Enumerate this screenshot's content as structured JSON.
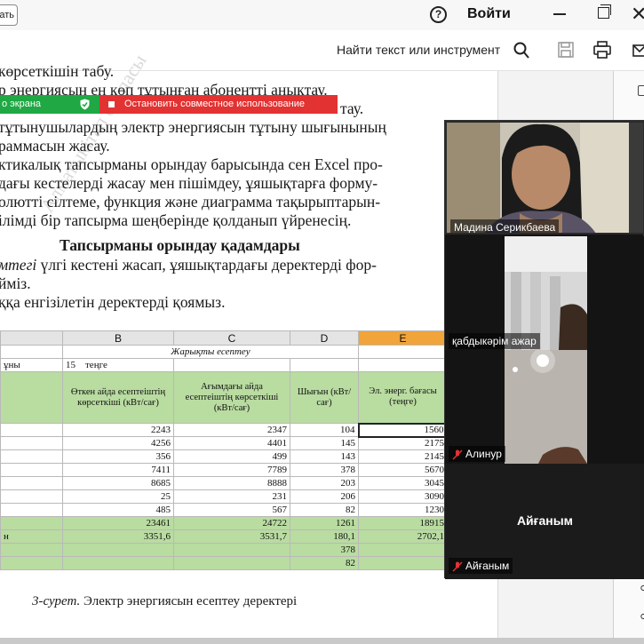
{
  "titlebar": {
    "left_button": "ать",
    "help_icon": "question-circle-icon",
    "login_label": "Войти"
  },
  "toolbar": {
    "find_label": "Найти текст или инструмент"
  },
  "share_bar": {
    "green_label": "о экрана",
    "red_label": "Остановить совместное использование"
  },
  "document": {
    "lines": [
      "көрсеткішін табу.",
      "р энергиясын ең көп тұтынған абонентті анықтау.",
      "",
      "тұтынушылардың электр энергиясын тұтыну шығынының",
      "раммасын жасау.",
      "ктикалық тапсырманы орындау барысында сен Excel про-",
      "дағы кестелерді жасау мен пішімдеу, ұяшықтарға форму-",
      "олютті сілтеме, функция және диаграмма тақырыптарын-",
      "ілімді бір тапсырма шеңберінде қолданып үйренесің."
    ],
    "line3_tail": "тау.",
    "heading": "Тапсырманы орындау қадамдары",
    "step1_italic": "мтегі",
    "step1_rest": " үлгі кестені жасап, ұяшықтардағы деректерді фор-",
    "step1_cont": "йміз.",
    "step2": "ққа енгізілетін деректерді қоямыз.",
    "watermark": "Алматыкітап баспасы",
    "caption_italic": "3-сурет.",
    "caption_rest": " Электр энергиясын есептеу деректері"
  },
  "sheet": {
    "columns": [
      "",
      "B",
      "C",
      "D",
      "E"
    ],
    "title_row": "Жарықты есептеу",
    "tariff_row": [
      "ұны",
      "15",
      "теңге"
    ],
    "headers": [
      "Өткен айда есептеіштің көрсеткіші (кВт/сағ)",
      "Ағымдағы айда есептеіштің көрсеткіші (кВт/сағ)",
      "Шығын (кВт/сағ)",
      "Эл. энерг. бағасы (теңге)"
    ],
    "rows": [
      [
        "",
        "2243",
        "2347",
        "104",
        "1560"
      ],
      [
        "",
        "4256",
        "4401",
        "145",
        "2175"
      ],
      [
        "",
        "356",
        "499",
        "143",
        "2145"
      ],
      [
        "",
        "7411",
        "7789",
        "378",
        "5670"
      ],
      [
        "",
        "8685",
        "8888",
        "203",
        "3045"
      ],
      [
        "",
        "25",
        "231",
        "206",
        "3090"
      ],
      [
        "",
        "485",
        "567",
        "82",
        "1230"
      ]
    ],
    "summary_rows": [
      [
        "",
        "23461",
        "24722",
        "1261",
        "18915"
      ],
      [
        "н",
        "3351,6",
        "3531,7",
        "180,1",
        "2702,1"
      ],
      [
        "",
        "",
        "",
        "378",
        ""
      ],
      [
        "",
        "",
        "",
        "82",
        ""
      ]
    ]
  },
  "video": {
    "participants": [
      {
        "name": "Мадина Серикбаева",
        "muted": false
      },
      {
        "name": "қабдыкәрім ажар",
        "muted": false
      },
      {
        "name": "Алинур",
        "muted": true
      },
      {
        "name": "Айғаным",
        "muted": true,
        "center_label": "Айғаным"
      }
    ]
  },
  "colors": {
    "share_green": "#1fa843",
    "share_red": "#e33232",
    "sheet_green": "#b9dca1",
    "selected_column": "#f0a43a"
  }
}
